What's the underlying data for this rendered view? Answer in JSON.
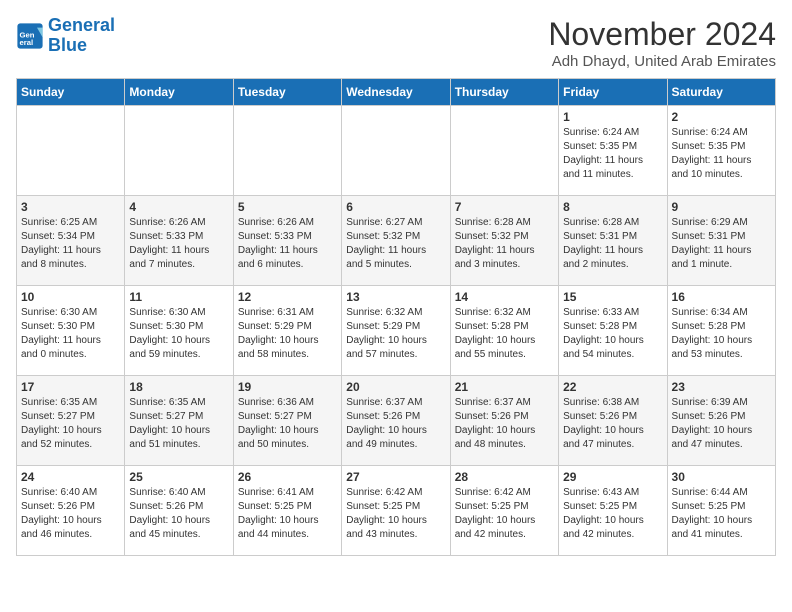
{
  "logo": {
    "text_general": "General",
    "text_blue": "Blue"
  },
  "header": {
    "month_year": "November 2024",
    "location": "Adh Dhayd, United Arab Emirates"
  },
  "days_of_week": [
    "Sunday",
    "Monday",
    "Tuesday",
    "Wednesday",
    "Thursday",
    "Friday",
    "Saturday"
  ],
  "weeks": [
    [
      {
        "day": "",
        "info": ""
      },
      {
        "day": "",
        "info": ""
      },
      {
        "day": "",
        "info": ""
      },
      {
        "day": "",
        "info": ""
      },
      {
        "day": "",
        "info": ""
      },
      {
        "day": "1",
        "info": "Sunrise: 6:24 AM\nSunset: 5:35 PM\nDaylight: 11 hours\nand 11 minutes."
      },
      {
        "day": "2",
        "info": "Sunrise: 6:24 AM\nSunset: 5:35 PM\nDaylight: 11 hours\nand 10 minutes."
      }
    ],
    [
      {
        "day": "3",
        "info": "Sunrise: 6:25 AM\nSunset: 5:34 PM\nDaylight: 11 hours\nand 8 minutes."
      },
      {
        "day": "4",
        "info": "Sunrise: 6:26 AM\nSunset: 5:33 PM\nDaylight: 11 hours\nand 7 minutes."
      },
      {
        "day": "5",
        "info": "Sunrise: 6:26 AM\nSunset: 5:33 PM\nDaylight: 11 hours\nand 6 minutes."
      },
      {
        "day": "6",
        "info": "Sunrise: 6:27 AM\nSunset: 5:32 PM\nDaylight: 11 hours\nand 5 minutes."
      },
      {
        "day": "7",
        "info": "Sunrise: 6:28 AM\nSunset: 5:32 PM\nDaylight: 11 hours\nand 3 minutes."
      },
      {
        "day": "8",
        "info": "Sunrise: 6:28 AM\nSunset: 5:31 PM\nDaylight: 11 hours\nand 2 minutes."
      },
      {
        "day": "9",
        "info": "Sunrise: 6:29 AM\nSunset: 5:31 PM\nDaylight: 11 hours\nand 1 minute."
      }
    ],
    [
      {
        "day": "10",
        "info": "Sunrise: 6:30 AM\nSunset: 5:30 PM\nDaylight: 11 hours\nand 0 minutes."
      },
      {
        "day": "11",
        "info": "Sunrise: 6:30 AM\nSunset: 5:30 PM\nDaylight: 10 hours\nand 59 minutes."
      },
      {
        "day": "12",
        "info": "Sunrise: 6:31 AM\nSunset: 5:29 PM\nDaylight: 10 hours\nand 58 minutes."
      },
      {
        "day": "13",
        "info": "Sunrise: 6:32 AM\nSunset: 5:29 PM\nDaylight: 10 hours\nand 57 minutes."
      },
      {
        "day": "14",
        "info": "Sunrise: 6:32 AM\nSunset: 5:28 PM\nDaylight: 10 hours\nand 55 minutes."
      },
      {
        "day": "15",
        "info": "Sunrise: 6:33 AM\nSunset: 5:28 PM\nDaylight: 10 hours\nand 54 minutes."
      },
      {
        "day": "16",
        "info": "Sunrise: 6:34 AM\nSunset: 5:28 PM\nDaylight: 10 hours\nand 53 minutes."
      }
    ],
    [
      {
        "day": "17",
        "info": "Sunrise: 6:35 AM\nSunset: 5:27 PM\nDaylight: 10 hours\nand 52 minutes."
      },
      {
        "day": "18",
        "info": "Sunrise: 6:35 AM\nSunset: 5:27 PM\nDaylight: 10 hours\nand 51 minutes."
      },
      {
        "day": "19",
        "info": "Sunrise: 6:36 AM\nSunset: 5:27 PM\nDaylight: 10 hours\nand 50 minutes."
      },
      {
        "day": "20",
        "info": "Sunrise: 6:37 AM\nSunset: 5:26 PM\nDaylight: 10 hours\nand 49 minutes."
      },
      {
        "day": "21",
        "info": "Sunrise: 6:37 AM\nSunset: 5:26 PM\nDaylight: 10 hours\nand 48 minutes."
      },
      {
        "day": "22",
        "info": "Sunrise: 6:38 AM\nSunset: 5:26 PM\nDaylight: 10 hours\nand 47 minutes."
      },
      {
        "day": "23",
        "info": "Sunrise: 6:39 AM\nSunset: 5:26 PM\nDaylight: 10 hours\nand 47 minutes."
      }
    ],
    [
      {
        "day": "24",
        "info": "Sunrise: 6:40 AM\nSunset: 5:26 PM\nDaylight: 10 hours\nand 46 minutes."
      },
      {
        "day": "25",
        "info": "Sunrise: 6:40 AM\nSunset: 5:26 PM\nDaylight: 10 hours\nand 45 minutes."
      },
      {
        "day": "26",
        "info": "Sunrise: 6:41 AM\nSunset: 5:25 PM\nDaylight: 10 hours\nand 44 minutes."
      },
      {
        "day": "27",
        "info": "Sunrise: 6:42 AM\nSunset: 5:25 PM\nDaylight: 10 hours\nand 43 minutes."
      },
      {
        "day": "28",
        "info": "Sunrise: 6:42 AM\nSunset: 5:25 PM\nDaylight: 10 hours\nand 42 minutes."
      },
      {
        "day": "29",
        "info": "Sunrise: 6:43 AM\nSunset: 5:25 PM\nDaylight: 10 hours\nand 42 minutes."
      },
      {
        "day": "30",
        "info": "Sunrise: 6:44 AM\nSunset: 5:25 PM\nDaylight: 10 hours\nand 41 minutes."
      }
    ]
  ]
}
